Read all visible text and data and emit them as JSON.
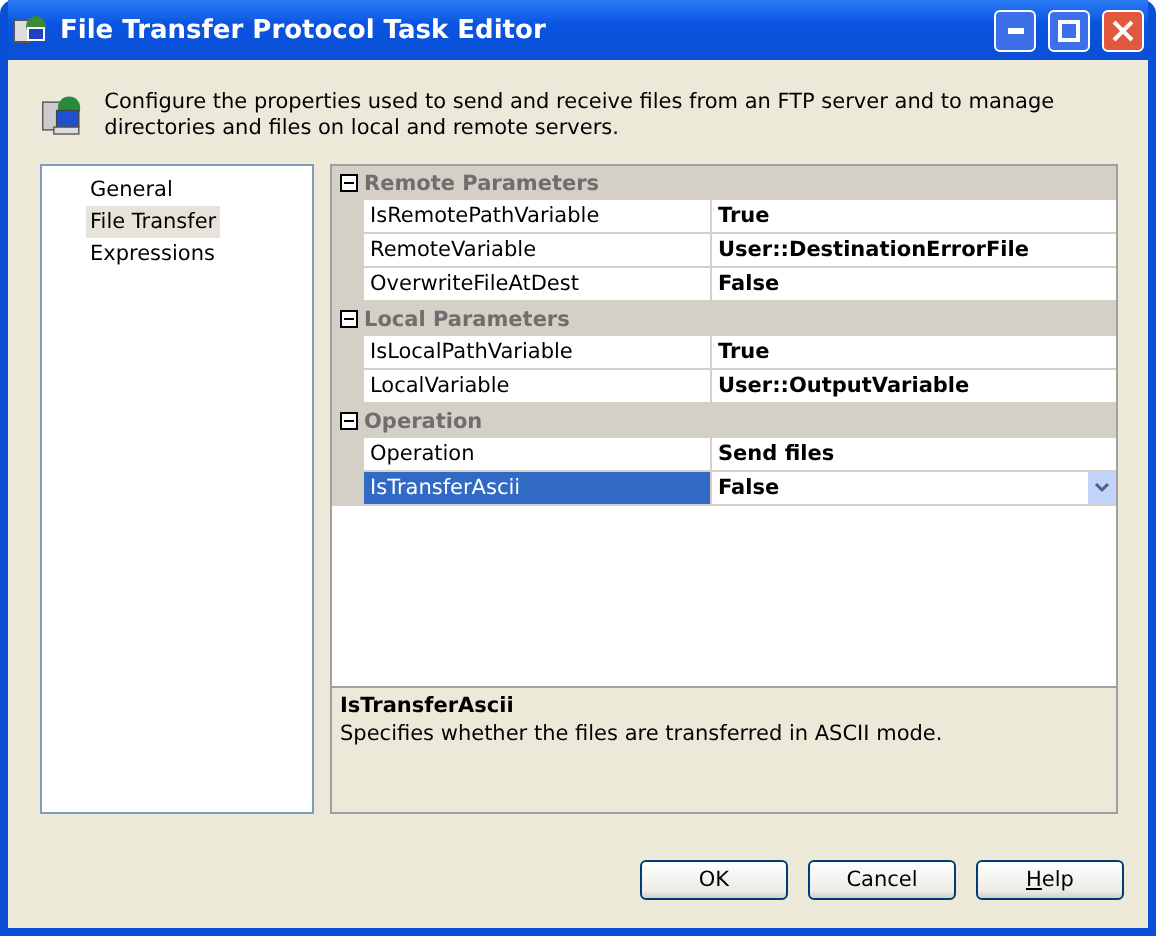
{
  "window": {
    "title": "File Transfer Protocol Task Editor"
  },
  "description": "Configure the properties used to send and receive files from an FTP server and to manage directories and files on local and remote servers.",
  "nav": [
    {
      "label": "General",
      "selected": false
    },
    {
      "label": "File Transfer",
      "selected": true
    },
    {
      "label": "Expressions",
      "selected": false
    }
  ],
  "categories": [
    {
      "name": "Remote Parameters",
      "expanded": true,
      "properties": [
        {
          "name": "IsRemotePathVariable",
          "value": "True",
          "selected": false
        },
        {
          "name": "RemoteVariable",
          "value": "User::DestinationErrorFile",
          "selected": false
        },
        {
          "name": "OverwriteFileAtDest",
          "value": "False",
          "selected": false
        }
      ]
    },
    {
      "name": "Local Parameters",
      "expanded": true,
      "properties": [
        {
          "name": "IsLocalPathVariable",
          "value": "True",
          "selected": false
        },
        {
          "name": "LocalVariable",
          "value": "User::OutputVariable",
          "selected": false
        }
      ]
    },
    {
      "name": "Operation",
      "expanded": true,
      "properties": [
        {
          "name": "Operation",
          "value": "Send files",
          "selected": false
        },
        {
          "name": "IsTransferAscii",
          "value": "False",
          "selected": true
        }
      ]
    }
  ],
  "help": {
    "title": "IsTransferAscii",
    "text": "Specifies whether the files are transferred in ASCII mode."
  },
  "buttons": [
    "OK",
    "Cancel",
    "Help"
  ]
}
